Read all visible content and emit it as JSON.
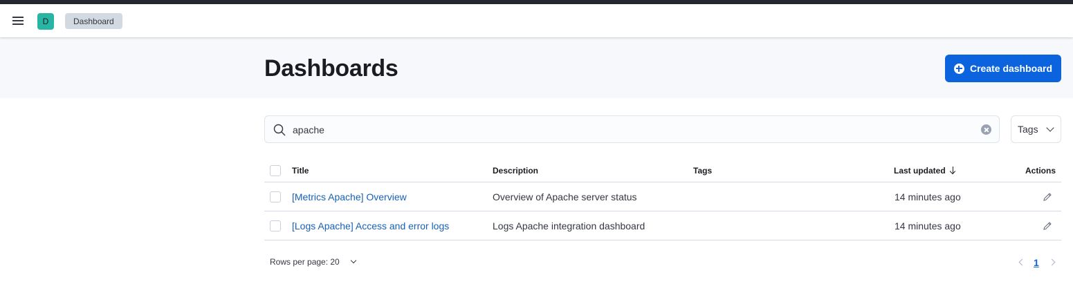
{
  "header": {
    "space_initial": "D",
    "breadcrumb": "Dashboard"
  },
  "page": {
    "title": "Dashboards",
    "create_button": "Create dashboard"
  },
  "search": {
    "value": "apache",
    "tags_label": "Tags"
  },
  "table": {
    "columns": {
      "title": "Title",
      "description": "Description",
      "tags": "Tags",
      "last_updated": "Last updated",
      "actions": "Actions"
    },
    "rows": [
      {
        "title": "[Metrics Apache] Overview",
        "description": "Overview of Apache server status",
        "tags": "",
        "last_updated": "14 minutes ago"
      },
      {
        "title": "[Logs Apache] Access and error logs",
        "description": "Logs Apache integration dashboard",
        "tags": "",
        "last_updated": "14 minutes ago"
      }
    ]
  },
  "pagination": {
    "rows_per_page": "Rows per page: 20",
    "current_page": "1"
  },
  "colors": {
    "primary": "#0b64dd",
    "link": "#1660b8",
    "avatar": "#29b5a4"
  }
}
